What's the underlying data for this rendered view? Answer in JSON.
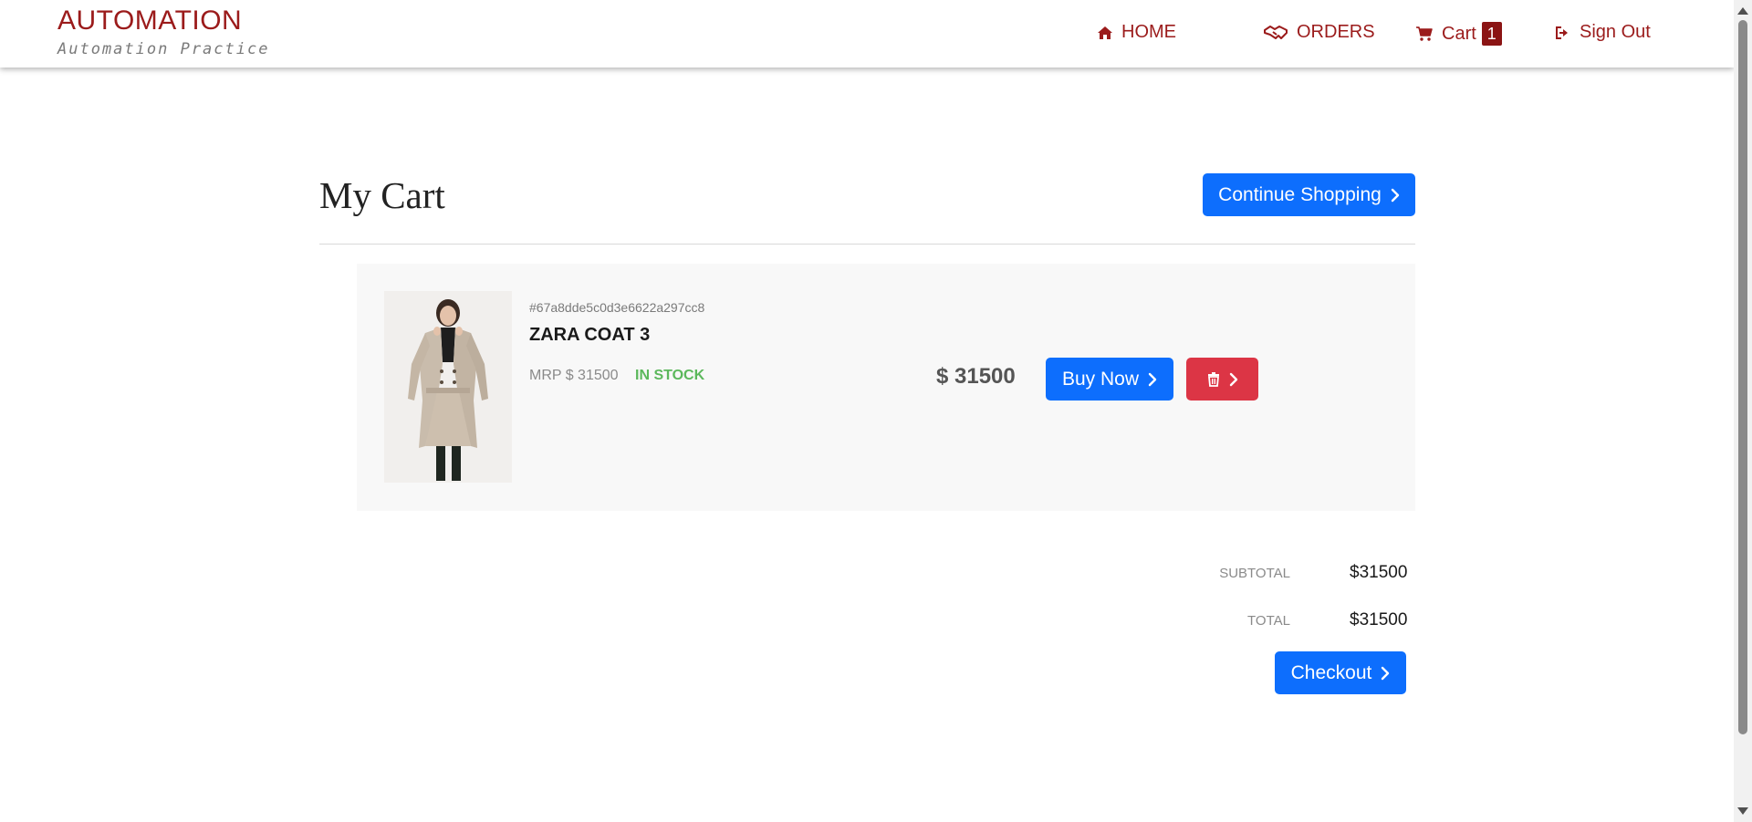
{
  "brand": {
    "title": "AUTOMATION",
    "subtitle": "Automation Practice"
  },
  "nav": {
    "home": "HOME",
    "orders": "ORDERS",
    "cart": "Cart",
    "cart_count": "1",
    "sign_out": "Sign Out"
  },
  "main": {
    "title": "My Cart",
    "continue_label": "Continue Shopping"
  },
  "cart_item": {
    "id": "#67a8dde5c0d3e6622a297cc8",
    "name": "ZARA COAT 3",
    "mrp": "MRP $ 31500",
    "stock": "IN STOCK",
    "price": "$ 31500",
    "buy_label": "Buy Now"
  },
  "summary": {
    "subtotal_label": "SUBTOTAL",
    "subtotal_value": "$31500",
    "total_label": "TOTAL",
    "total_value": "$31500",
    "checkout_label": "Checkout"
  },
  "colors": {
    "brand": "#9b1b1b",
    "primary": "#0d6efd",
    "danger": "#dc3545",
    "in_stock": "#5cb85c"
  }
}
